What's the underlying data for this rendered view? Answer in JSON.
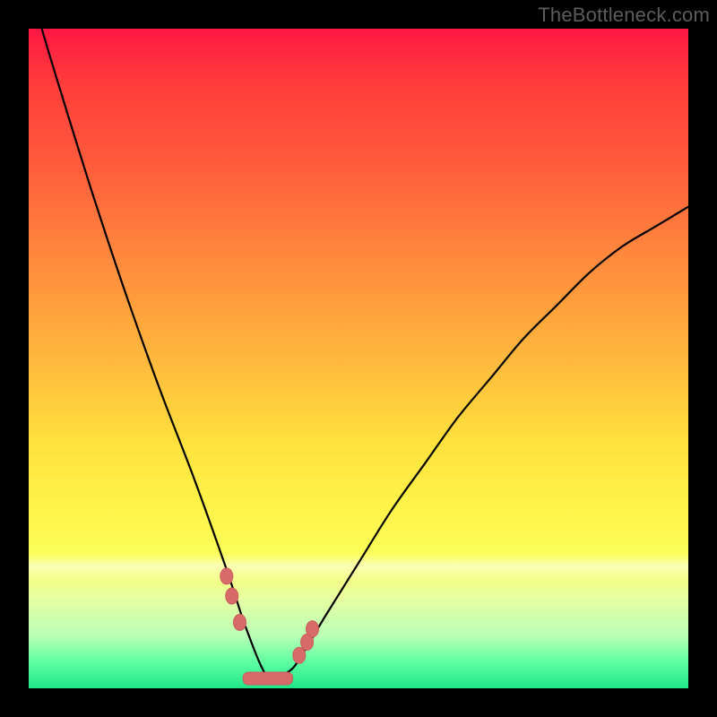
{
  "watermark": "TheBottleneck.com",
  "colors": {
    "background": "#000000",
    "curve": "#000000",
    "marker": "#d96a6a"
  },
  "chart_data": {
    "type": "line",
    "title": "",
    "xlabel": "",
    "ylabel": "",
    "xlim": [
      0,
      100
    ],
    "ylim": [
      0,
      100
    ],
    "grid": false,
    "legend": false,
    "note": "Axes are unlabeled; values are normalized 0-100 by position. x across the plot width, y is height above baseline (0 = bottom, 100 = top). Curve is a V-shaped bottleneck profile with the minimum near x≈36.",
    "series": [
      {
        "name": "bottleneck-curve",
        "x": [
          0,
          2,
          5,
          10,
          15,
          20,
          25,
          30,
          33,
          36,
          38,
          40,
          42,
          45,
          50,
          55,
          60,
          65,
          70,
          75,
          80,
          85,
          90,
          95,
          100
        ],
        "y": [
          108,
          100,
          90,
          74,
          59,
          45,
          32,
          18,
          9,
          2,
          2,
          3,
          6,
          11,
          19,
          27,
          34,
          41,
          47,
          53,
          58,
          63,
          67,
          70,
          73
        ]
      }
    ],
    "markers": {
      "name": "near-minimum-points",
      "x": [
        30.0,
        30.8,
        32.0,
        41.0,
        42.2,
        43.0
      ],
      "y": [
        17,
        14,
        10,
        5,
        7,
        9
      ]
    },
    "valley_segment": {
      "x_start": 32.5,
      "x_end": 40.0,
      "y": 1.5
    },
    "gradient_stops_percent_from_top": {
      "red": 0,
      "orange": 35,
      "yellow": 63,
      "pale": 82,
      "green": 100
    }
  }
}
